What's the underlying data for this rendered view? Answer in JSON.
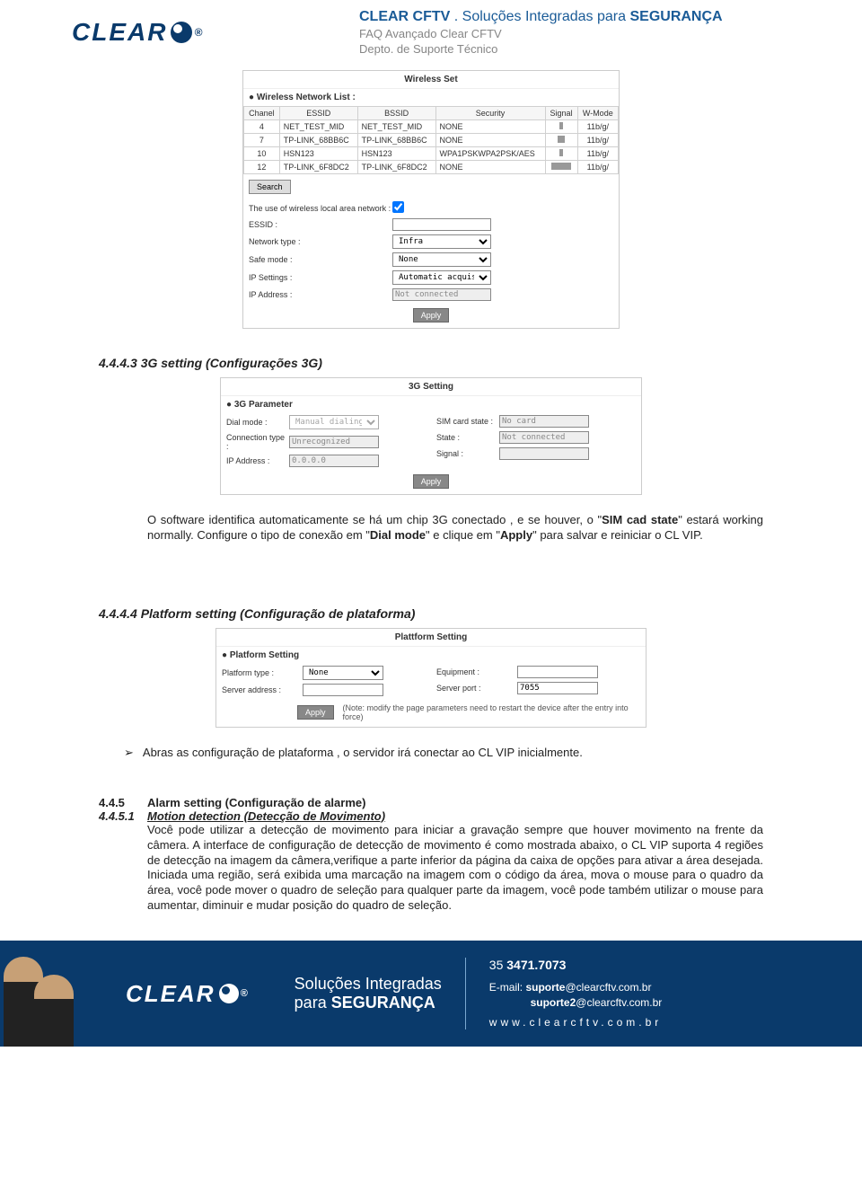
{
  "header": {
    "brand": "CLEAR",
    "reg": "®",
    "title_prefix": "CLEAR CFTV",
    "title_dot": " . ",
    "title_mid": "Soluções Integradas para ",
    "title_bold": "SEGURANÇA",
    "line2": "FAQ Avançado Clear CFTV",
    "line3": "Depto. de Suporte Técnico"
  },
  "wireless": {
    "title": "Wireless Set",
    "list_label": "Wireless Network List :",
    "cols": [
      "Chanel",
      "ESSID",
      "BSSID",
      "Security",
      "Signal",
      "W-Mode"
    ],
    "rows": [
      {
        "ch": "4",
        "essid": "NET_TEST_MID",
        "bssid": "NET_TEST_MID",
        "sec": "NONE",
        "sig": 4,
        "mode": "11b/g/"
      },
      {
        "ch": "7",
        "essid": "TP-LINK_68BB6C",
        "bssid": "TP-LINK_68BB6C",
        "sec": "NONE",
        "sig": 8,
        "mode": "11b/g/"
      },
      {
        "ch": "10",
        "essid": "HSN123",
        "bssid": "HSN123",
        "sec": "WPA1PSKWPA2PSK/AES",
        "sig": 4,
        "mode": "11b/g/"
      },
      {
        "ch": "12",
        "essid": "TP-LINK_6F8DC2",
        "bssid": "TP-LINK_6F8DC2",
        "sec": "NONE",
        "sig": 22,
        "mode": "11b/g/"
      }
    ],
    "search": "Search",
    "use_lan": "The use of wireless local area network :",
    "essid": "ESSID :",
    "nettype": "Network type :",
    "safe": "Safe mode :",
    "ipset": "IP Settings :",
    "ipaddr": "IP Address :",
    "nettype_val": "Infra",
    "safe_val": "None",
    "ipset_val": "Automatic acquisitio",
    "ipaddr_val": "Not connected",
    "apply": "Apply"
  },
  "sec_4443": {
    "heading": "4.4.4.3  3G setting (Configurações 3G)",
    "body_before_sim": "O software identifica automaticamente se há um chip 3G conectado , e se houver, o \"",
    "sim": "SIM cad state",
    "body_mid1": "\" estará working normally. Configure o tipo de conexão em \"",
    "dial": "Dial mode",
    "body_mid2": "\" e clique em \"",
    "applyb": "Apply",
    "body_after": "\" para salvar e reiniciar o CL VIP."
  },
  "g3": {
    "title": "3G Setting",
    "param": "3G Parameter",
    "dial_lbl": "Dial mode :",
    "dial_val": "Manual dialing",
    "conn_lbl": "Connection type :",
    "conn_val": "Unrecognized",
    "ip_lbl": "IP Address :",
    "ip_val": "0.0.0.0",
    "sim_lbl": "SIM card state :",
    "sim_val": "No card",
    "state_lbl": "State :",
    "state_val": "Not connected",
    "sig_lbl": "Signal :",
    "apply": "Apply"
  },
  "sec_4444": {
    "heading": "4.4.4.4  Platform setting (Configuração de plataforma)",
    "bullet": "Abras as configuração de plataforma , o servidor irá conectar ao CL VIP inicialmente."
  },
  "plat": {
    "title": "Plattform Setting",
    "sect": "Platform Setting",
    "ptype_lbl": "Platform type :",
    "ptype_val": "None",
    "serv_lbl": "Server address :",
    "eq_lbl": "Equipment :",
    "port_lbl": "Server port :",
    "port_val": "7055",
    "apply": "Apply",
    "note": "(Note: modify the page parameters need to restart the device after the entry into force)"
  },
  "sec_445": {
    "num": "4.4.5",
    "title": "Alarm setting (Configuração de alarme)"
  },
  "sec_4451": {
    "num": "4.4.5.1",
    "title": "Motion detection (Detecção de Movimento)",
    "body": "Você pode utilizar a detecção de movimento para iniciar a gravação sempre que houver movimento na frente da câmera. A interface de configuração de detecção de movimento é como mostrada abaixo, o CL VIP suporta 4 regiões de detecção na imagem da câmera,verifique a parte inferior da página da caixa de opções para ativar a área desejada. Iniciada uma região, será exibida uma marcação na imagem com o código da área, mova o mouse para o quadro da área, você pode mover o quadro de seleção para qualquer parte da imagem, você pode também utilizar o mouse para aumentar, diminuir e mudar posição do quadro de seleção."
  },
  "footer": {
    "brand": "CLEAR",
    "reg": "®",
    "mid1": "Soluções Integradas",
    "mid2_pre": "para ",
    "mid2_bold": "SEGURANÇA",
    "phone_pre": "35 ",
    "phone_bold": "3471.7073",
    "email_lbl": "E-mail: ",
    "email1_b": "suporte",
    "email1_r": "@clearcftv.com.br",
    "email2_b": "suporte2",
    "email2_r": "@clearcftv.com.br",
    "site": "www.clearcftv.com.br"
  }
}
